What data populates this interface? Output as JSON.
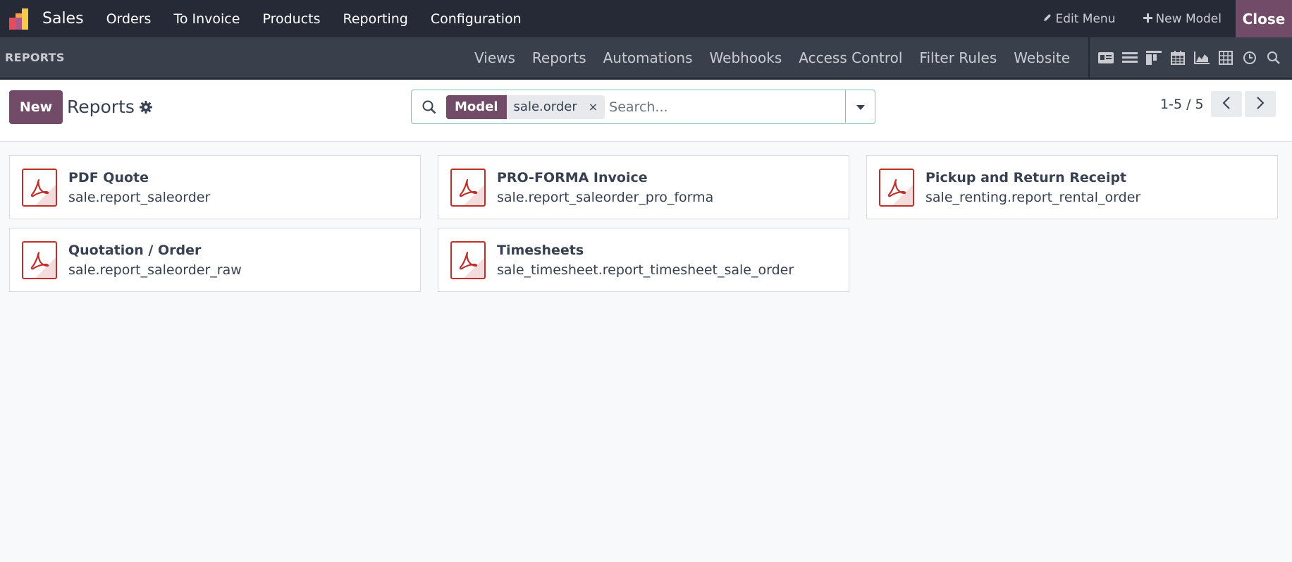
{
  "topbar": {
    "app_name": "Sales",
    "menu": [
      "Orders",
      "To Invoice",
      "Products",
      "Reporting",
      "Configuration"
    ],
    "edit_menu": "Edit Menu",
    "new_model": "New Model",
    "close": "Close"
  },
  "studio": {
    "title": "REPORTS",
    "menu": [
      "Views",
      "Reports",
      "Automations",
      "Webhooks",
      "Access Control",
      "Filter Rules",
      "Website"
    ],
    "view_icons": [
      "form-view-icon",
      "list-view-icon",
      "kanban-view-icon",
      "calendar-view-icon",
      "graph-view-icon",
      "pivot-view-icon",
      "activity-view-icon",
      "search-view-icon"
    ]
  },
  "control": {
    "new_label": "New",
    "title": "Reports",
    "facet_label": "Model",
    "facet_value": "sale.order",
    "facet_remove": "×",
    "search_placeholder": "Search...",
    "pager": "1-5 / 5"
  },
  "reports": [
    {
      "name": "PDF Quote",
      "model": "sale.report_saleorder"
    },
    {
      "name": "PRO-FORMA Invoice",
      "model": "sale.report_saleorder_pro_forma"
    },
    {
      "name": "Pickup and Return Receipt",
      "model": "sale_renting.report_rental_order"
    },
    {
      "name": "Quotation / Order",
      "model": "sale.report_saleorder_raw"
    },
    {
      "name": "Timesheets",
      "model": "sale_timesheet.report_timesheet_sale_order"
    }
  ],
  "colors": {
    "brand": "#714b67",
    "navbar": "#262a36",
    "studiobar": "#3a3f4c",
    "pdf_red": "#c0302b",
    "search_border": "#7ec1bf"
  }
}
